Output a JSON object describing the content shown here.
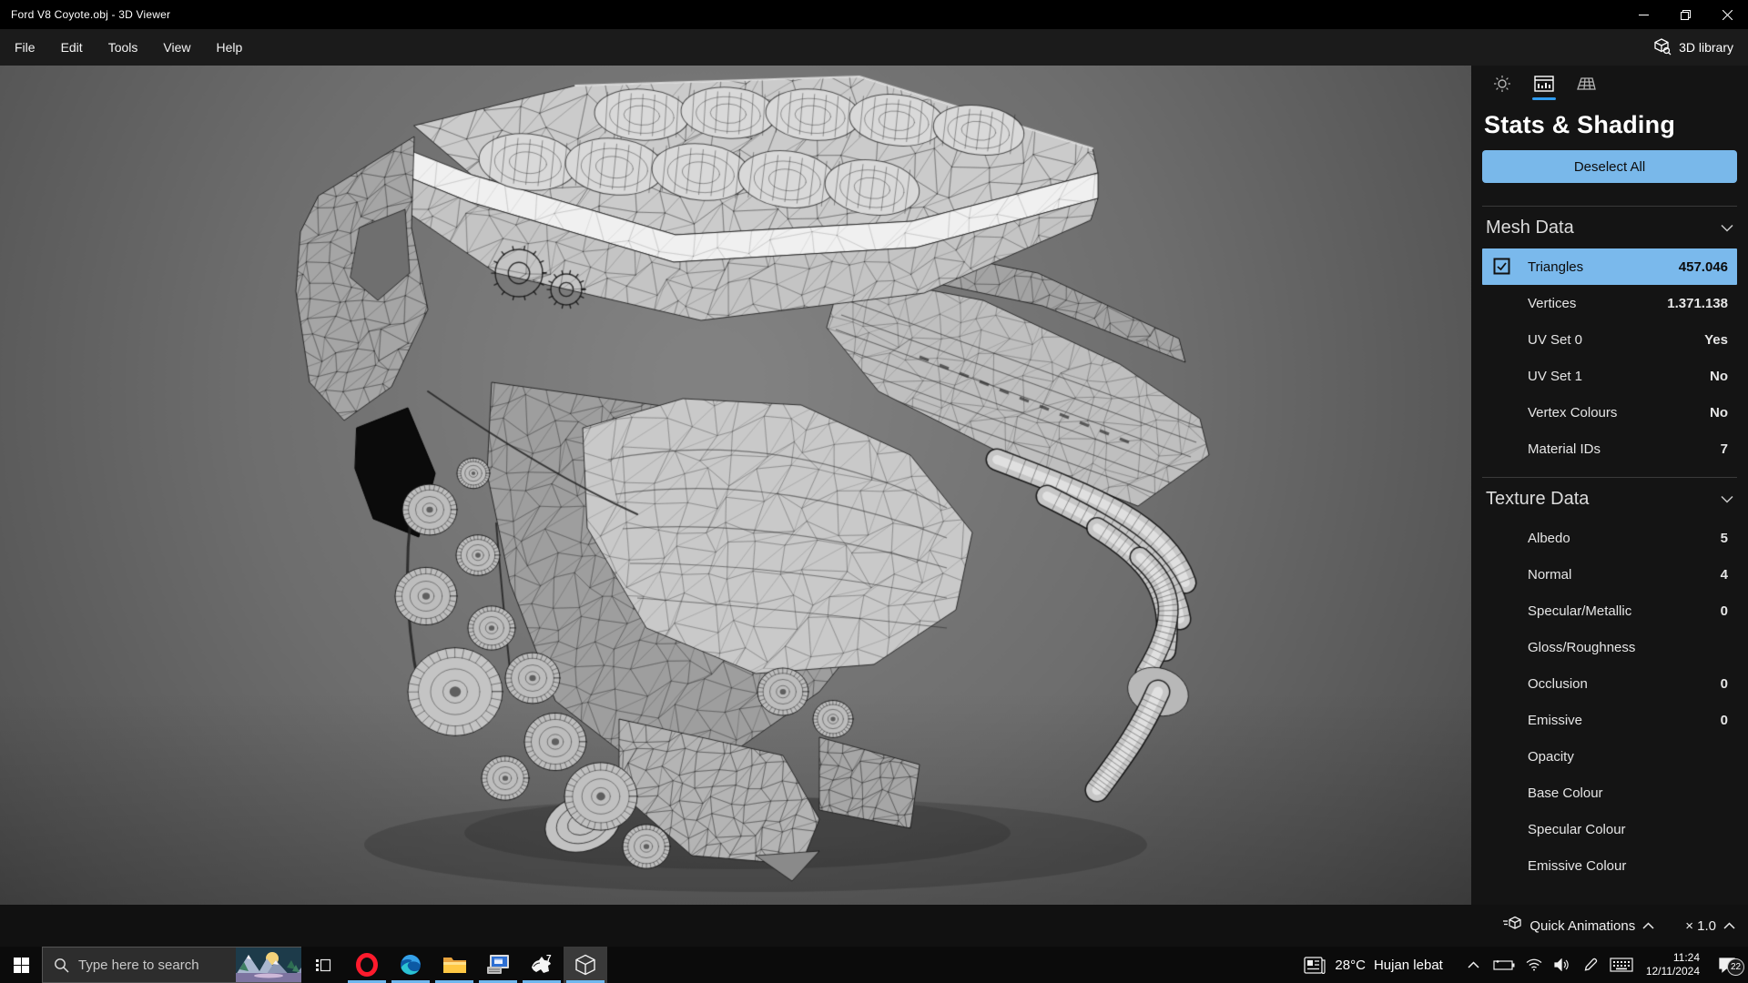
{
  "window": {
    "title": "Ford V8 Coyote.obj - 3D Viewer"
  },
  "menubar": {
    "items": [
      "File",
      "Edit",
      "Tools",
      "View",
      "Help"
    ],
    "library": "3D library"
  },
  "panel": {
    "title": "Stats & Shading",
    "deselect_all": "Deselect All",
    "mesh_section": {
      "title": "Mesh Data",
      "rows": [
        {
          "label": "Triangles",
          "value": "457.046"
        },
        {
          "label": "Vertices",
          "value": "1.371.138"
        },
        {
          "label": "UV Set 0",
          "value": "Yes"
        },
        {
          "label": "UV Set 1",
          "value": "No"
        },
        {
          "label": "Vertex Colours",
          "value": "No"
        },
        {
          "label": "Material IDs",
          "value": "7"
        }
      ]
    },
    "texture_section": {
      "title": "Texture Data",
      "rows": [
        {
          "label": "Albedo",
          "value": "5"
        },
        {
          "label": "Normal",
          "value": "4"
        },
        {
          "label": "Specular/Metallic",
          "value": "0"
        },
        {
          "label": "Gloss/Roughness",
          "value": ""
        },
        {
          "label": "Occlusion",
          "value": "0"
        },
        {
          "label": "Emissive",
          "value": "0"
        },
        {
          "label": "Opacity",
          "value": ""
        },
        {
          "label": "Base Colour",
          "value": ""
        },
        {
          "label": "Specular Colour",
          "value": ""
        },
        {
          "label": "Emissive Colour",
          "value": ""
        }
      ]
    },
    "footer": {
      "quick_animations": "Quick Animations",
      "speed": "× 1.0"
    }
  },
  "taskbar": {
    "search_placeholder": "Type here to search",
    "tray": {
      "temperature": "28°C",
      "weather": "Hujan lebat",
      "time": "11:24",
      "date": "12/11/2024",
      "badge": "22"
    }
  },
  "colors": {
    "accent_blue": "#79b8ea",
    "tab_underline": "#2f9bef",
    "taskbar_underline": "#6fb7ee"
  }
}
